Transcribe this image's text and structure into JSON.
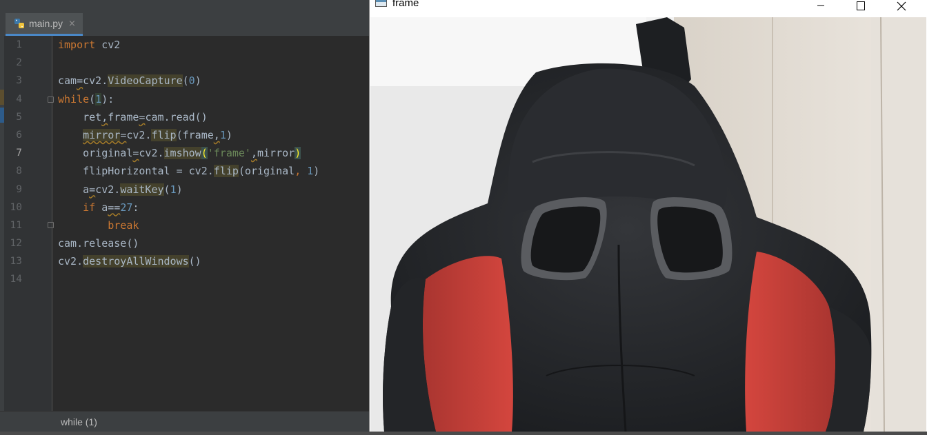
{
  "editor": {
    "tab": {
      "label": "main.py",
      "close": "×",
      "icon": "python-file-icon"
    },
    "current_line": 7,
    "line_numbers": [
      "1",
      "2",
      "3",
      "4",
      "5",
      "6",
      "7",
      "8",
      "9",
      "10",
      "11",
      "12",
      "13",
      "14"
    ],
    "breadcrumb": "while (1)"
  },
  "cv_window": {
    "title": "frame",
    "controls": [
      "minimize-icon",
      "maximize-icon",
      "close-icon"
    ],
    "image": "webcam frame showing a black and red gaming chair headrest against a white wall"
  },
  "colors": {
    "keyword": "#cc7832",
    "number": "#6897bb",
    "string": "#6a8759",
    "text": "#a9b7c6",
    "chair_red": "#c43b35",
    "chair_black": "#26282b"
  }
}
